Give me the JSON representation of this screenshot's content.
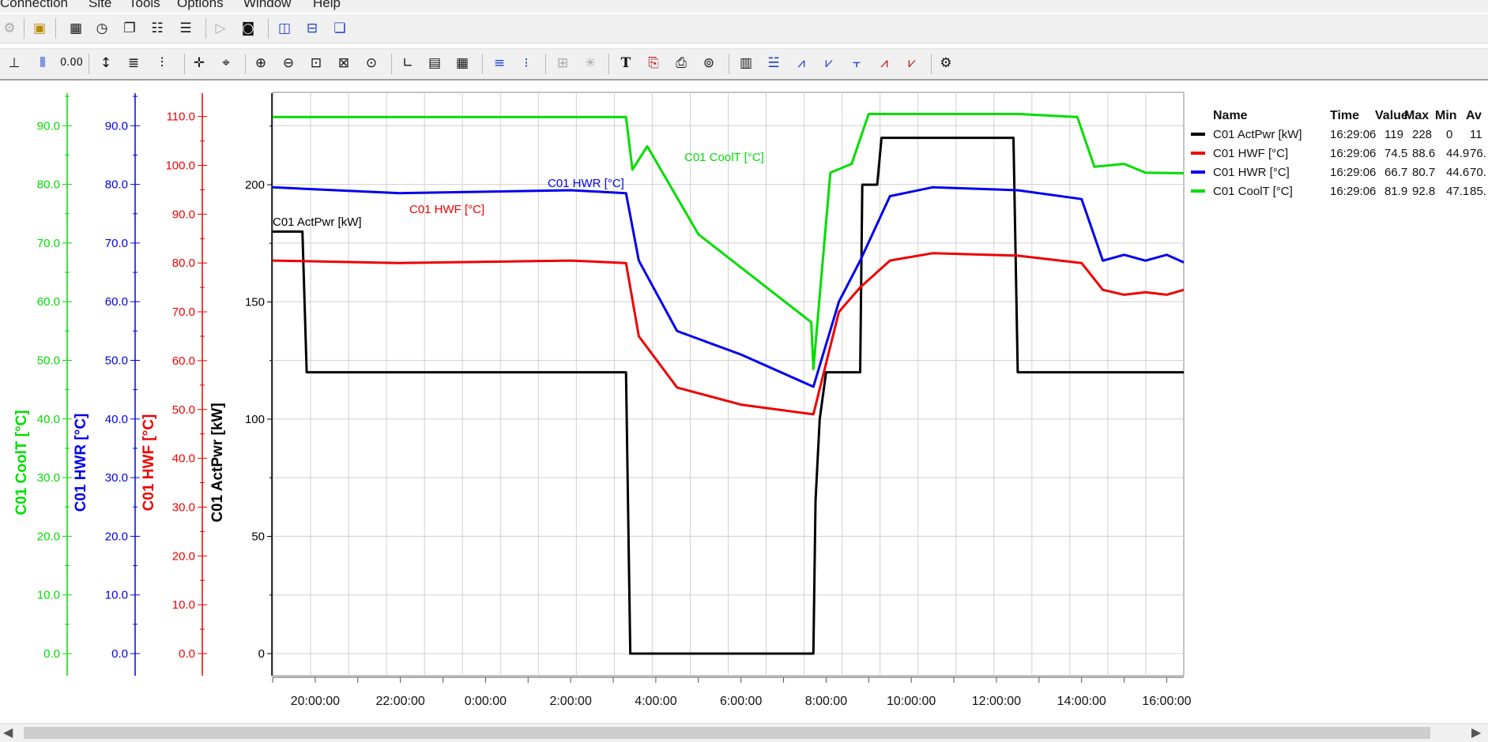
{
  "menubar": {
    "items": [
      "Connection",
      "Site",
      "Tools",
      "Options",
      "Window",
      "Help"
    ]
  },
  "toolbar1": {
    "icons": [
      "plug-icon",
      "open-folder-icon",
      "calendar-icon",
      "clock-icon",
      "copy-pages-icon",
      "trend-window-icon",
      "list-window-icon",
      "play-icon",
      "stop-icon",
      "tile-vertical-icon",
      "tile-horizontal-icon",
      "cascade-icon"
    ]
  },
  "toolbar2": {
    "icons": [
      "axis-x-icon",
      "axis-multi-icon",
      "digits-icon",
      "cursor-icon",
      "align-icon",
      "stack-icon",
      "pan-icon",
      "pan-zoom-icon",
      "zoom-in-icon",
      "zoom-out-icon",
      "zoom-box-icon",
      "zoom-fit-icon",
      "zoom-area-icon",
      "axes-corner-icon",
      "grid-light-icon",
      "grid-dark-icon",
      "lines-icon",
      "points-icon",
      "marker-disabled-icon",
      "asterisk-disabled-icon",
      "text-tool-icon",
      "export-icon",
      "print-icon",
      "print-preview-icon",
      "table-icon",
      "list-numbered-icon",
      "chart-type-1-icon",
      "chart-type-2-icon",
      "chart-type-3-icon",
      "chart-type-4-icon",
      "chart-type-5-icon",
      "properties-icon"
    ]
  },
  "chart_data": {
    "type": "line",
    "x_ticks": [
      "20:00:00",
      "22:00:00",
      "0:00:00",
      "2:00:00",
      "4:00:00",
      "6:00:00",
      "8:00:00",
      "10:00:00",
      "12:00:00",
      "14:00:00",
      "16:00:00"
    ],
    "axes": [
      {
        "label": "C01 CoolT [°C]",
        "color": "#00dd00",
        "ticks": [
          "0.0",
          "10.0",
          "20.0",
          "30.0",
          "40.0",
          "50.0",
          "60.0",
          "70.0",
          "80.0",
          "90.0"
        ],
        "range": [
          0,
          90
        ]
      },
      {
        "label": "C01 HWR [°C]",
        "color": "#0000ee",
        "ticks": [
          "0.0",
          "10.0",
          "20.0",
          "30.0",
          "40.0",
          "50.0",
          "60.0",
          "70.0",
          "80.0",
          "90.0"
        ],
        "range": [
          0,
          90
        ]
      },
      {
        "label": "C01 HWF [°C]",
        "color": "#ee0000",
        "ticks": [
          "0.0",
          "10.0",
          "20.0",
          "30.0",
          "40.0",
          "50.0",
          "60.0",
          "70.0",
          "80.0",
          "90.0",
          "100.0",
          "110.0"
        ],
        "range": [
          0,
          110
        ]
      },
      {
        "label": "C01 ActPwr [kW]",
        "color": "#000000",
        "ticks": [
          "0",
          "50",
          "100",
          "150",
          "200"
        ],
        "range": [
          0,
          200
        ]
      }
    ],
    "series": [
      {
        "name": "C01 ActPwr [kW]",
        "color": "#000000",
        "x": [
          19.0,
          19.7,
          19.8,
          23.0,
          2.0,
          3.3,
          3.4,
          7.7,
          7.75,
          7.85,
          8.0,
          8.8,
          8.85,
          9.2,
          9.3,
          12.4,
          12.5,
          14.0,
          16.4
        ],
        "y": [
          180,
          180,
          120,
          120,
          120,
          120,
          0,
          0,
          65,
          100,
          120,
          120,
          200,
          200,
          220,
          220,
          120,
          120,
          120
        ]
      },
      {
        "name": "C01 HWF [°C]",
        "color": "#ee0000",
        "x": [
          19.0,
          22.0,
          2.0,
          3.3,
          3.6,
          4.5,
          6.0,
          7.7,
          8.3,
          8.8,
          9.5,
          10.5,
          12.5,
          14.0,
          14.5,
          15.0,
          15.5,
          16.0,
          16.4
        ],
        "y": [
          80.5,
          80.0,
          80.5,
          80.0,
          65.0,
          54.5,
          51.0,
          49.0,
          70.0,
          75.0,
          80.5,
          82.0,
          81.5,
          80.0,
          74.5,
          73.5,
          74.0,
          73.5,
          74.5
        ]
      },
      {
        "name": "C01 HWR [°C]",
        "color": "#0000ee",
        "x": [
          19.0,
          22.0,
          2.0,
          3.3,
          3.6,
          4.5,
          6.0,
          7.7,
          8.3,
          8.8,
          9.5,
          10.5,
          12.5,
          14.0,
          14.5,
          15.0,
          15.5,
          16.0,
          16.4
        ],
        "y": [
          79.5,
          78.5,
          79.0,
          78.5,
          67.0,
          55.0,
          51.0,
          45.5,
          60.0,
          67.0,
          78.0,
          79.5,
          79.0,
          77.5,
          67.0,
          68.0,
          67.0,
          68.0,
          66.7
        ]
      },
      {
        "name": "C01 CoolT [°C]",
        "color": "#00dd00",
        "x": [
          19.0,
          22.0,
          2.0,
          3.3,
          3.45,
          3.8,
          5.0,
          7.65,
          7.7,
          8.1,
          8.6,
          9.0,
          9.3,
          12.5,
          13.9,
          14.3,
          15.0,
          15.5,
          16.4
        ],
        "y": [
          91.5,
          91.5,
          91.5,
          91.5,
          82.5,
          86.5,
          71.5,
          56.5,
          48.5,
          82.0,
          83.5,
          92.0,
          92.0,
          92.0,
          91.5,
          83.0,
          83.5,
          82.0,
          81.9
        ]
      }
    ],
    "series_labels": [
      "C01 ActPwr [kW]",
      "C01 HWF [°C]",
      "C01 HWR [°C]",
      "C01 CoolT [°C]"
    ],
    "legend": {
      "headers": [
        "Name",
        "Time",
        "Value",
        "Max",
        "Min",
        "Av"
      ],
      "rows": [
        {
          "name": "C01 ActPwr [kW]",
          "color": "#000000",
          "time": "16:29:06",
          "value": "119",
          "max": "228",
          "min": "0",
          "av": "11"
        },
        {
          "name": "C01 HWF [°C]",
          "color": "#ee0000",
          "time": "16:29:06",
          "value": "74.5",
          "max": "88.6",
          "min": "44.9",
          "av": "76."
        },
        {
          "name": "C01 HWR [°C]",
          "color": "#0000ee",
          "time": "16:29:06",
          "value": "66.7",
          "max": "80.7",
          "min": "44.6",
          "av": "70."
        },
        {
          "name": "C01 CoolT [°C]",
          "color": "#00dd00",
          "time": "16:29:06",
          "value": "81.9",
          "max": "92.8",
          "min": "47.1",
          "av": "85."
        }
      ],
      "placement": "right"
    },
    "grid": true
  }
}
